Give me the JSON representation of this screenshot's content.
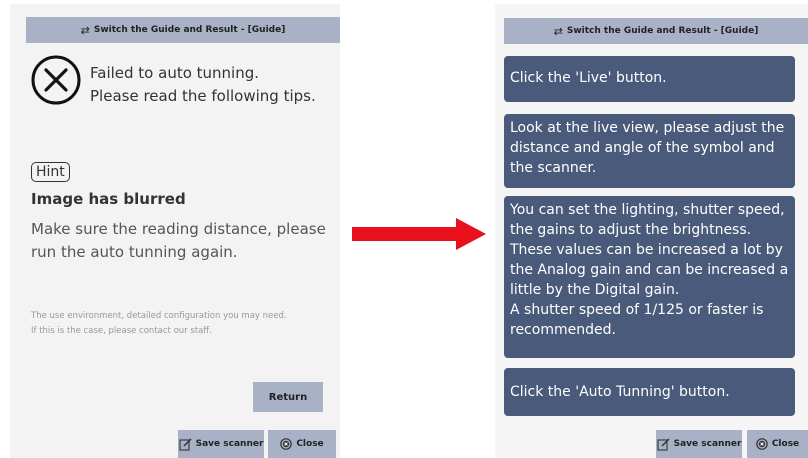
{
  "left": {
    "switch_label": "Switch the Guide and Result - [Guide]",
    "fail_line1": "Failed to auto tunning.",
    "fail_line2": "Please read the following tips.",
    "hint_badge": "Hint",
    "hint_title": "Image has blurred",
    "hint_body": "Make sure the reading distance, please run the auto tunning again.",
    "note_line1": "The use environment, detailed configuration you may need.",
    "note_line2": "If this is the case, please contact our staff.",
    "return_label": "Return",
    "save_label": "Save scanner",
    "close_label": "Close"
  },
  "right": {
    "switch_label": "Switch the Guide and Result - [Guide]",
    "steps": [
      "Click the 'Live' button.",
      "Look at the live view, please adjust the distance and angle of the symbol and the scanner.",
      "You can set the lighting, shutter speed, the gains to adjust the brightness. These values can be increased a lot by the Analog gain and can be increased a little by the Digital gain.",
      "A shutter speed of 1/125 or faster is recommended.",
      "Click the 'Auto Tunning' button."
    ],
    "save_label": "Save scanner",
    "close_label": "Close"
  },
  "icons": {
    "swap": "swap-arrows-icon",
    "fail": "x-circle-icon",
    "save": "edit-note-icon",
    "close": "close-circle-icon",
    "arrow": "right-arrow"
  },
  "colors": {
    "button_bg": "#a9b1c7",
    "step_bg": "#4a5a7a",
    "arrow": "#e8101a",
    "panel_bg": "#f3f3f4"
  }
}
